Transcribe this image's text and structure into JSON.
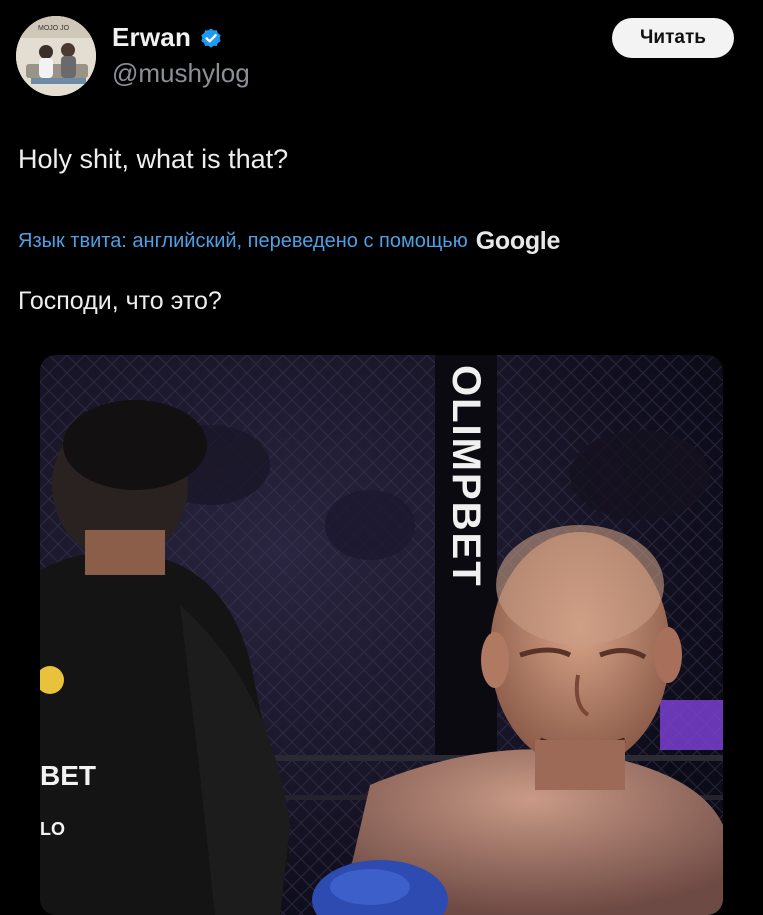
{
  "author": {
    "display_name": "Erwan",
    "handle": "@mushylog",
    "verified": true,
    "avatar_caption": "MOJO JO"
  },
  "follow_button": {
    "label": "Читать"
  },
  "tweet": {
    "text": "Holy shit, what is that?"
  },
  "translation": {
    "label": "Язык твита: английский, переведено с помощью",
    "provider": "Google",
    "text": "Господи, что это?"
  },
  "media": {
    "cage_sponsor_text": "OLIMPBET",
    "shirt_logo_text": "BET",
    "shirt_lower_text": "LO"
  },
  "colors": {
    "background": "#000000",
    "link": "#4f9fe4",
    "verified": "#1d9bf0",
    "secondary_text": "#8b9096"
  }
}
